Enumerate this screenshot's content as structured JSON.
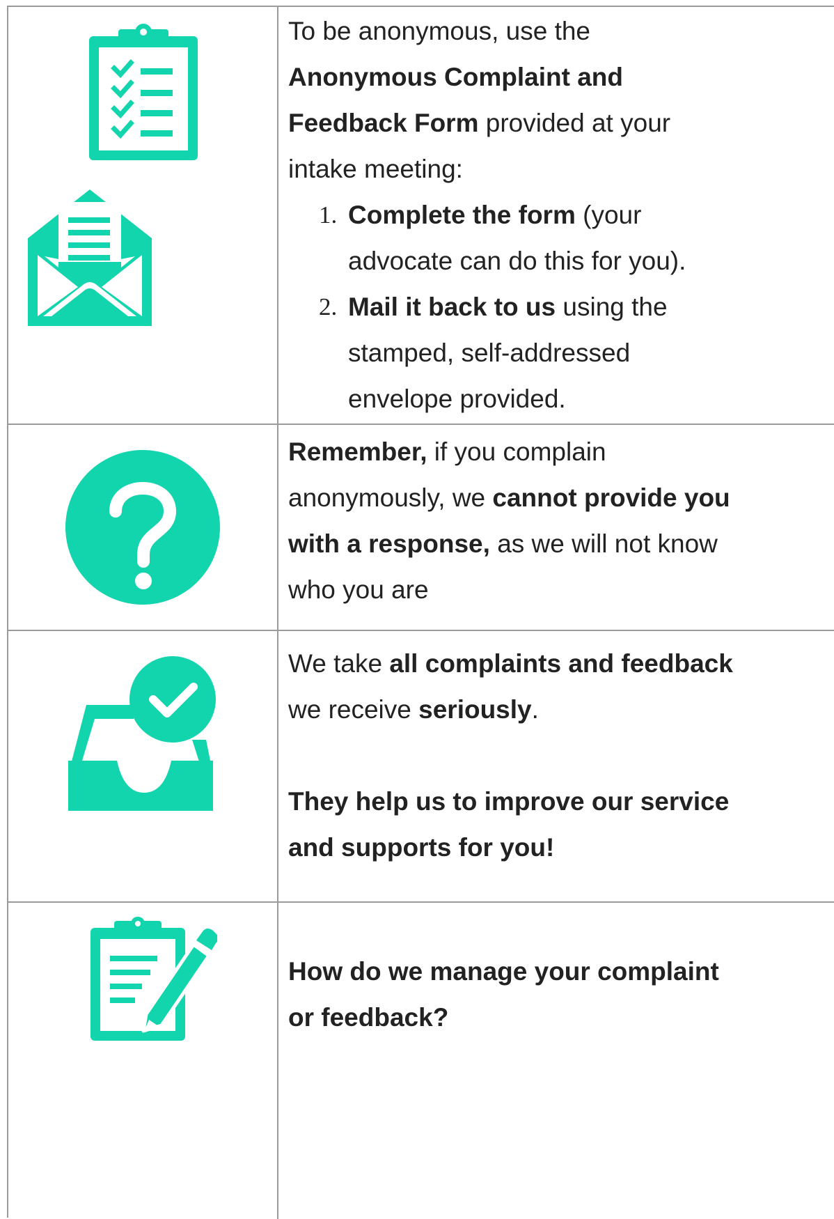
{
  "colors": {
    "accent": "#12d4ad",
    "border": "#9a9a9a",
    "text": "#222222"
  },
  "rows": [
    {
      "icons": [
        "clipboard-checklist-icon",
        "open-envelope-letter-icon"
      ],
      "intro": {
        "p1": "To be anonymous, use the",
        "bold1": "Anonymous Complaint and",
        "bold2": "Feedback Form",
        "p2": " provided at your",
        "p3": "intake meeting:"
      },
      "steps": [
        {
          "number": "1.",
          "bold": "Complete the form",
          "rest": " (your",
          "line2": "advocate can do this for you)."
        },
        {
          "number": "2.",
          "bold": "Mail it back to us",
          "rest": " using the",
          "line2": "stamped, self-addressed",
          "line3": "envelope provided."
        }
      ]
    },
    {
      "icons": [
        "question-mark-circle-icon"
      ],
      "l1_bold": "Remember,",
      "l1_rest": " if you complain",
      "l2_rest": "anonymously, we ",
      "l2_bold": "cannot provide you",
      "l3_bold": "with a response,",
      "l3_rest": " as we will not know",
      "l4": "who you are"
    },
    {
      "icons": [
        "inbox-checkmark-icon"
      ],
      "l1_rest": "We take ",
      "l1_bold": "all complaints and feedback",
      "l2_rest": "we receive ",
      "l2_bold": "seriously",
      "l2_end": ".",
      "l3_bold": "They help us to improve our service",
      "l4_bold": "and supports for you!"
    },
    {
      "icons": [
        "clipboard-pencil-icon"
      ],
      "l1_bold": "How do we manage your complaint",
      "l2_bold": "or feedback?"
    }
  ]
}
